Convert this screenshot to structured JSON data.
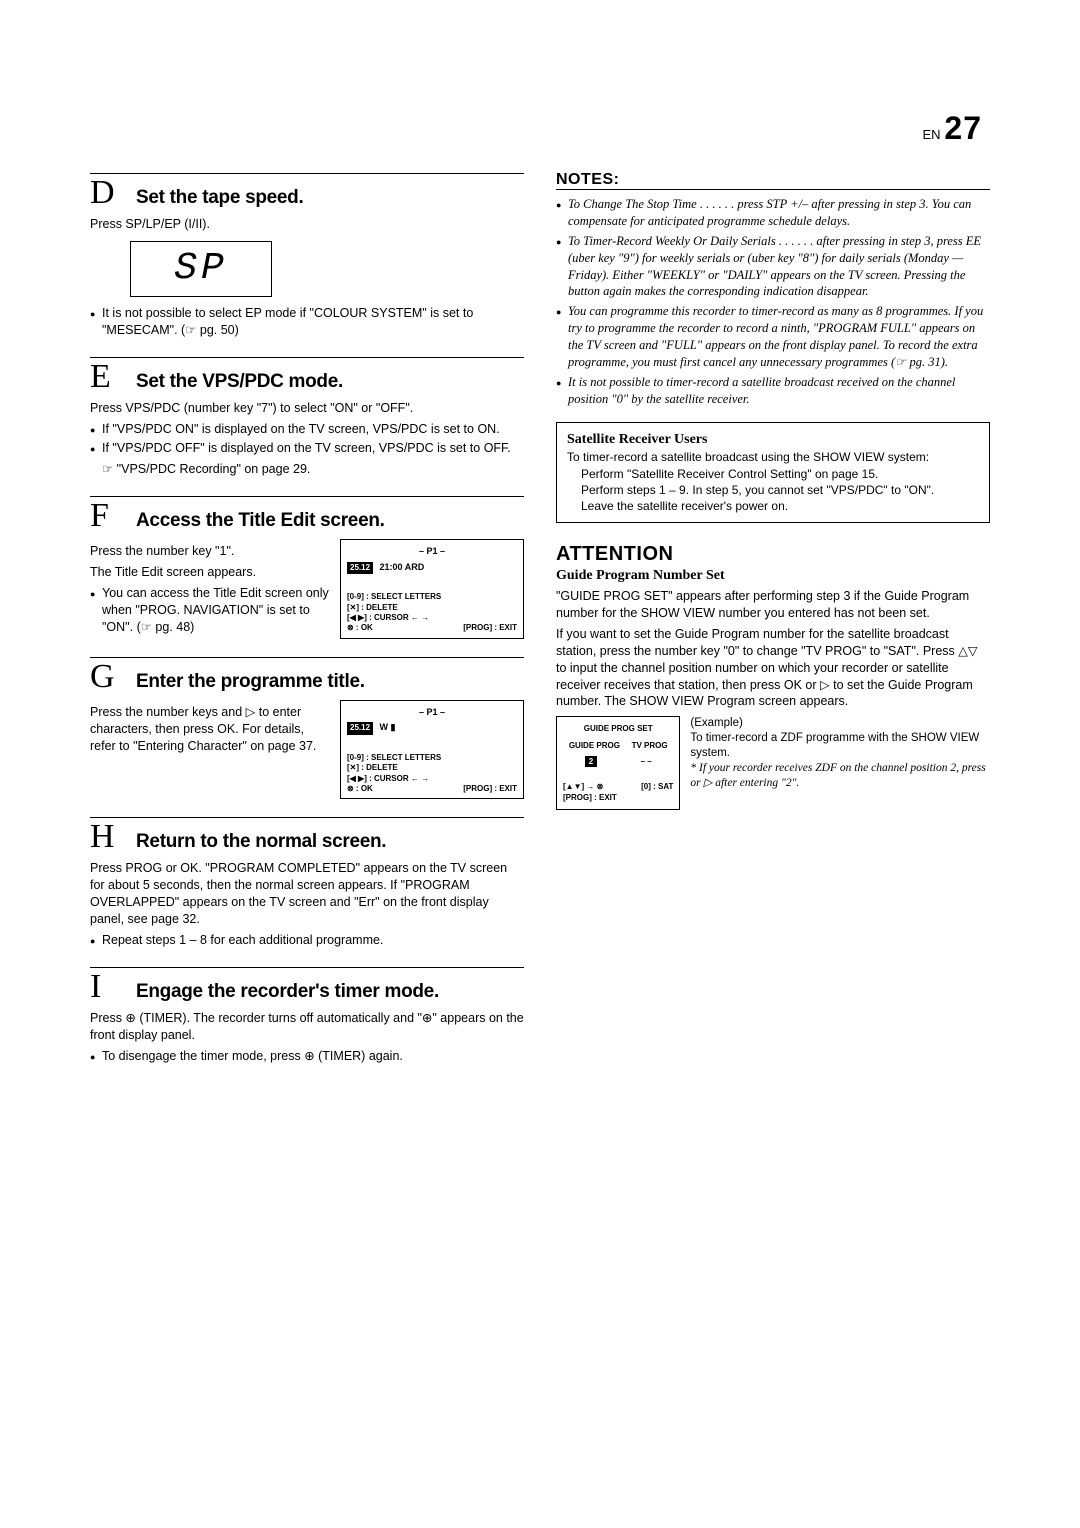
{
  "page": {
    "prefix": "EN",
    "number": "27"
  },
  "left": {
    "D": {
      "letter": "D",
      "title": "Set the tape speed.",
      "press": "Press SP/LP/EP (I/II).",
      "display": "SP",
      "note1": "It is not possible to select EP mode if \"COLOUR SYSTEM\" is set to \"MESECAM\". (☞ pg. 50)"
    },
    "E": {
      "letter": "E",
      "title": "Set the VPS/PDC mode.",
      "press": "Press VPS/PDC (number key \"7\") to select \"ON\" or \"OFF\".",
      "n1": "If \"VPS/PDC ON\" is displayed on the TV screen, VPS/PDC is set to ON.",
      "n2": "If \"VPS/PDC OFF\" is displayed on the TV screen, VPS/PDC is set to OFF.",
      "ref": "☞ \"VPS/PDC Recording\" on page 29."
    },
    "F": {
      "letter": "F",
      "title": "Access the Title Edit screen.",
      "p1": "Press the number key \"1\".",
      "p2": "The Title Edit screen appears.",
      "n1": "You can access the Title Edit screen only when \"PROG. NAVIGATION\" is set to \"ON\". (☞ pg. 48)",
      "screen": {
        "hdr": "– P1 –",
        "date": "25.12",
        "time": "21:00 ARD",
        "l1": "[0-9] : SELECT LETTERS",
        "l2": "[✕] : DELETE",
        "l3": "[◀ ▶] : CURSOR ← →",
        "l4a": "⊗ : OK",
        "l4b": "[PROG] : EXIT"
      }
    },
    "G": {
      "letter": "G",
      "title": "Enter the programme title.",
      "p1": "Press the number keys and ▷ to enter characters, then press OK. For details, refer to \"Entering Character\" on page 37.",
      "screen": {
        "hdr": "– P1 –",
        "date": "25.12",
        "entry": "W ▮",
        "l1": "[0-9] : SELECT LETTERS",
        "l2": "[✕] : DELETE",
        "l3": "[◀ ▶] : CURSOR ← →",
        "l4a": "⊗ : OK",
        "l4b": "[PROG] : EXIT"
      }
    },
    "H": {
      "letter": "H",
      "title": "Return to the normal screen.",
      "p1": "Press PROG or OK. \"PROGRAM COMPLETED\" appears on the TV screen for about 5 seconds, then the normal screen appears. If \"PROGRAM OVERLAPPED\" appears on the TV screen and \"Err\" on the front display panel, see page 32.",
      "n1": "Repeat steps 1 – 8 for each additional programme."
    },
    "I": {
      "letter": "I",
      "title": "Engage the recorder's timer mode.",
      "p1": "Press ⊕ (TIMER). The recorder turns off automatically and \"⊕\" appears on the front display panel.",
      "n1": "To disengage the timer mode, press ⊕ (TIMER) again."
    }
  },
  "right": {
    "notes_head": "NOTES:",
    "n1": "To Change The Stop Time . . .\n. . . press STP +/– after pressing   in step 3. You can compensate for anticipated programme schedule delays.",
    "n2": "To Timer-Record Weekly Or Daily Serials . . .\n. . . after pressing   in step 3, press EE   (uber key \"9\") for weekly serials or   (uber key \"8\") for daily serials (Monday — Friday). Either \"WEEKLY\" or \"DAILY\" appears on the TV screen. Pressing the button again makes the corresponding indication disappear.",
    "n3": "You can programme this recorder to timer-record as many as 8 programmes. If you try to programme the recorder to record a ninth, \"PROGRAM FULL\" appears on the TV screen and \"FULL\" appears on the front display panel. To record the extra programme, you must first cancel any unnecessary programmes (☞ pg. 31).",
    "n4": "It is not possible to timer-record a satellite broadcast received on the channel position \"0\" by the satellite receiver.",
    "sat": {
      "title": "Satellite Receiver Users",
      "p1": "To timer-record a satellite broadcast using the SHOW VIEW system:",
      "s1": "Perform \"Satellite Receiver Control Setting\" on page 15.",
      "s2": "Perform steps 1 – 9. In step 5, you cannot set \"VPS/PDC\" to \"ON\".",
      "s3": "Leave the satellite receiver's power on."
    },
    "attention": {
      "head": "ATTENTION",
      "sub": "Guide Program Number Set",
      "p1": "\"GUIDE PROG SET\" appears after performing step 3 if the Guide Program number for the SHOW VIEW number you entered has not been set.",
      "p2": "If you want to set the Guide Program number for the satellite broadcast station, press the number key \"0\" to change \"TV PROG\" to \"SAT\". Press △▽ to input the channel position number on which your recorder or satellite receiver receives that station, then press OK or ▷ to set the Guide Program number. The SHOW VIEW Program screen appears.",
      "box": {
        "title": "GUIDE PROG SET",
        "c1": "GUIDE PROG",
        "c2": "TV PROG",
        "v1": "2",
        "v2": "– –",
        "l1": "[▲▼] → ⊗",
        "l2": "[0] : SAT",
        "l3": "[PROG] : EXIT"
      },
      "example": {
        "lead": "(Example)",
        "p1": "To timer-record a ZDF programme with the SHOW VIEW system.",
        "p2": "* If your recorder receives ZDF on the channel position 2, press   or ▷ after entering \"2\"."
      }
    }
  }
}
